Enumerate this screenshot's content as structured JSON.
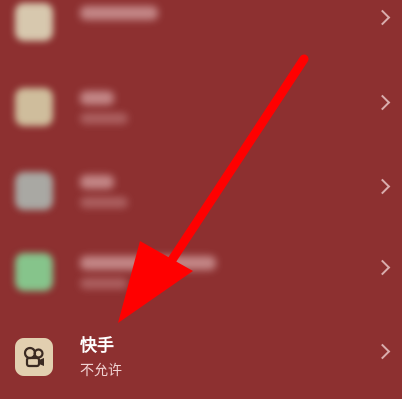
{
  "items": [
    {
      "icon": "app-icon",
      "blurred": true
    },
    {
      "icon": "app-icon",
      "blurred": true
    },
    {
      "icon": "app-icon",
      "blurred": true
    },
    {
      "icon": "app-icon",
      "blurred": true
    },
    {
      "icon": "kuaishou-icon",
      "name": "快手",
      "status": "不允许",
      "blurred": false
    }
  ],
  "arrow": {
    "icon": "red-arrow-pointer",
    "color": "#ff0000"
  },
  "colors": {
    "background": "#8d3030",
    "accent": "#ff0000"
  }
}
